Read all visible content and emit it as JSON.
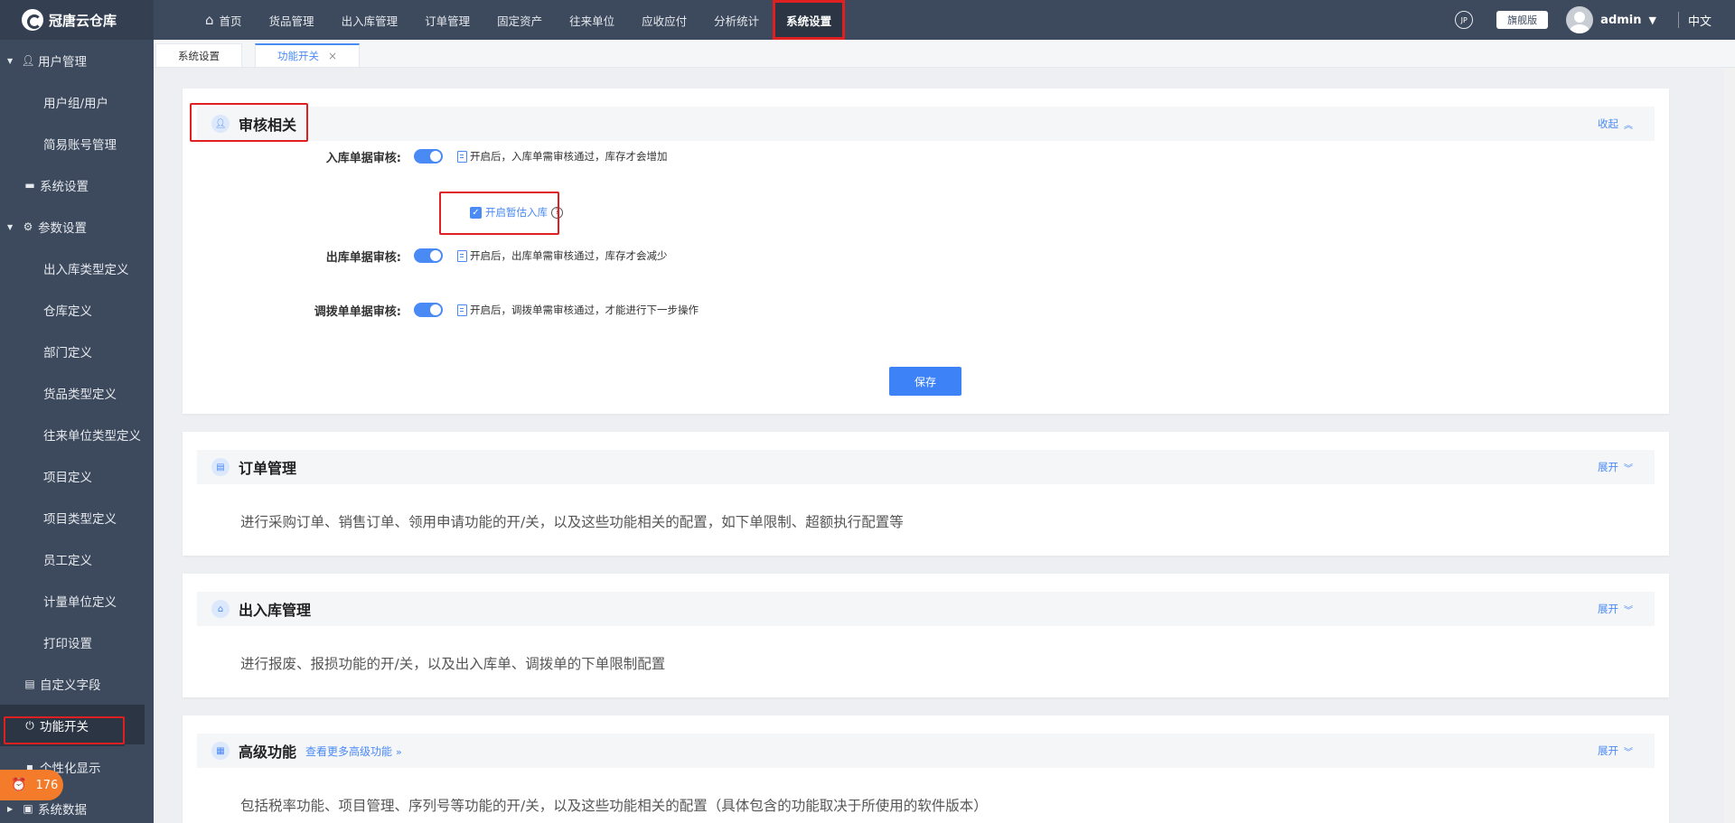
{
  "app": {
    "name": "冠唐云仓库",
    "edition": "旗舰版",
    "user": "admin",
    "language": "中文",
    "jp_icon_text": "JP"
  },
  "nav": {
    "items": [
      {
        "label": "首页",
        "active": false
      },
      {
        "label": "货品管理",
        "active": false
      },
      {
        "label": "出入库管理",
        "active": false
      },
      {
        "label": "订单管理",
        "active": false
      },
      {
        "label": "固定资产",
        "active": false
      },
      {
        "label": "往来单位",
        "active": false
      },
      {
        "label": "应收应付",
        "active": false
      },
      {
        "label": "分析统计",
        "active": false
      },
      {
        "label": "系统设置",
        "active": true
      }
    ]
  },
  "sidebar": {
    "user_mgmt": "用户管理",
    "user_group": "用户组/用户",
    "simple_account": "简易账号管理",
    "system_settings": "系统设置",
    "param_settings": "参数设置",
    "param_items": [
      "出入库类型定义",
      "仓库定义",
      "部门定义",
      "货品类型定义",
      "往来单位类型定义",
      "项目定义",
      "项目类型定义",
      "员工定义",
      "计量单位定义",
      "打印设置"
    ],
    "custom_fields": "自定义字段",
    "feature_switch": "功能开关",
    "personalized": "个性化显示",
    "system_data": "系统数据",
    "badge_count": "176"
  },
  "tabs": [
    {
      "label": "系统设置",
      "active": false
    },
    {
      "label": "功能开关",
      "active": true
    }
  ],
  "audit": {
    "title": "审核相关",
    "collapse": "收起",
    "inbound_label": "入库单据审核:",
    "inbound_tip": "开启后，入库单需审核通过，库存才会增加",
    "estimate_label": "开启暂估入库",
    "outbound_label": "出库单据审核:",
    "outbound_tip": "开启后，出库单需审核通过，库存才会减少",
    "transfer_label": "调拨单单据审核:",
    "transfer_tip": "开启后，调拨单需审核通过，才能进行下一步操作",
    "save": "保存",
    "switches": {
      "inbound": true,
      "outbound": true,
      "transfer": true,
      "estimate_checked": true
    }
  },
  "order": {
    "title": "订单管理",
    "expand": "展开",
    "desc": "进行采购订单、销售订单、领用申请功能的开/关，以及这些功能相关的配置，如下单限制、超额执行配置等"
  },
  "inout": {
    "title": "出入库管理",
    "expand": "展开",
    "desc": "进行报废、报损功能的开/关，以及出入库单、调拨单的下单限制配置"
  },
  "advanced": {
    "title": "高级功能",
    "more": "查看更多高级功能",
    "expand": "展开",
    "desc": "包括税率功能、项目管理、序列号等功能的开/关，以及这些功能相关的配置（具体包含的功能取决于所使用的软件版本）"
  },
  "colors": {
    "primary": "#4a8af4",
    "nav_bg": "#3d4a5d",
    "highlight": "#e02020",
    "badge": "#f47b2a"
  },
  "icons": {
    "home": "home-icon",
    "user": "user-icon",
    "gear": "gear-icon",
    "monitor": "monitor-icon",
    "power": "power-icon"
  }
}
